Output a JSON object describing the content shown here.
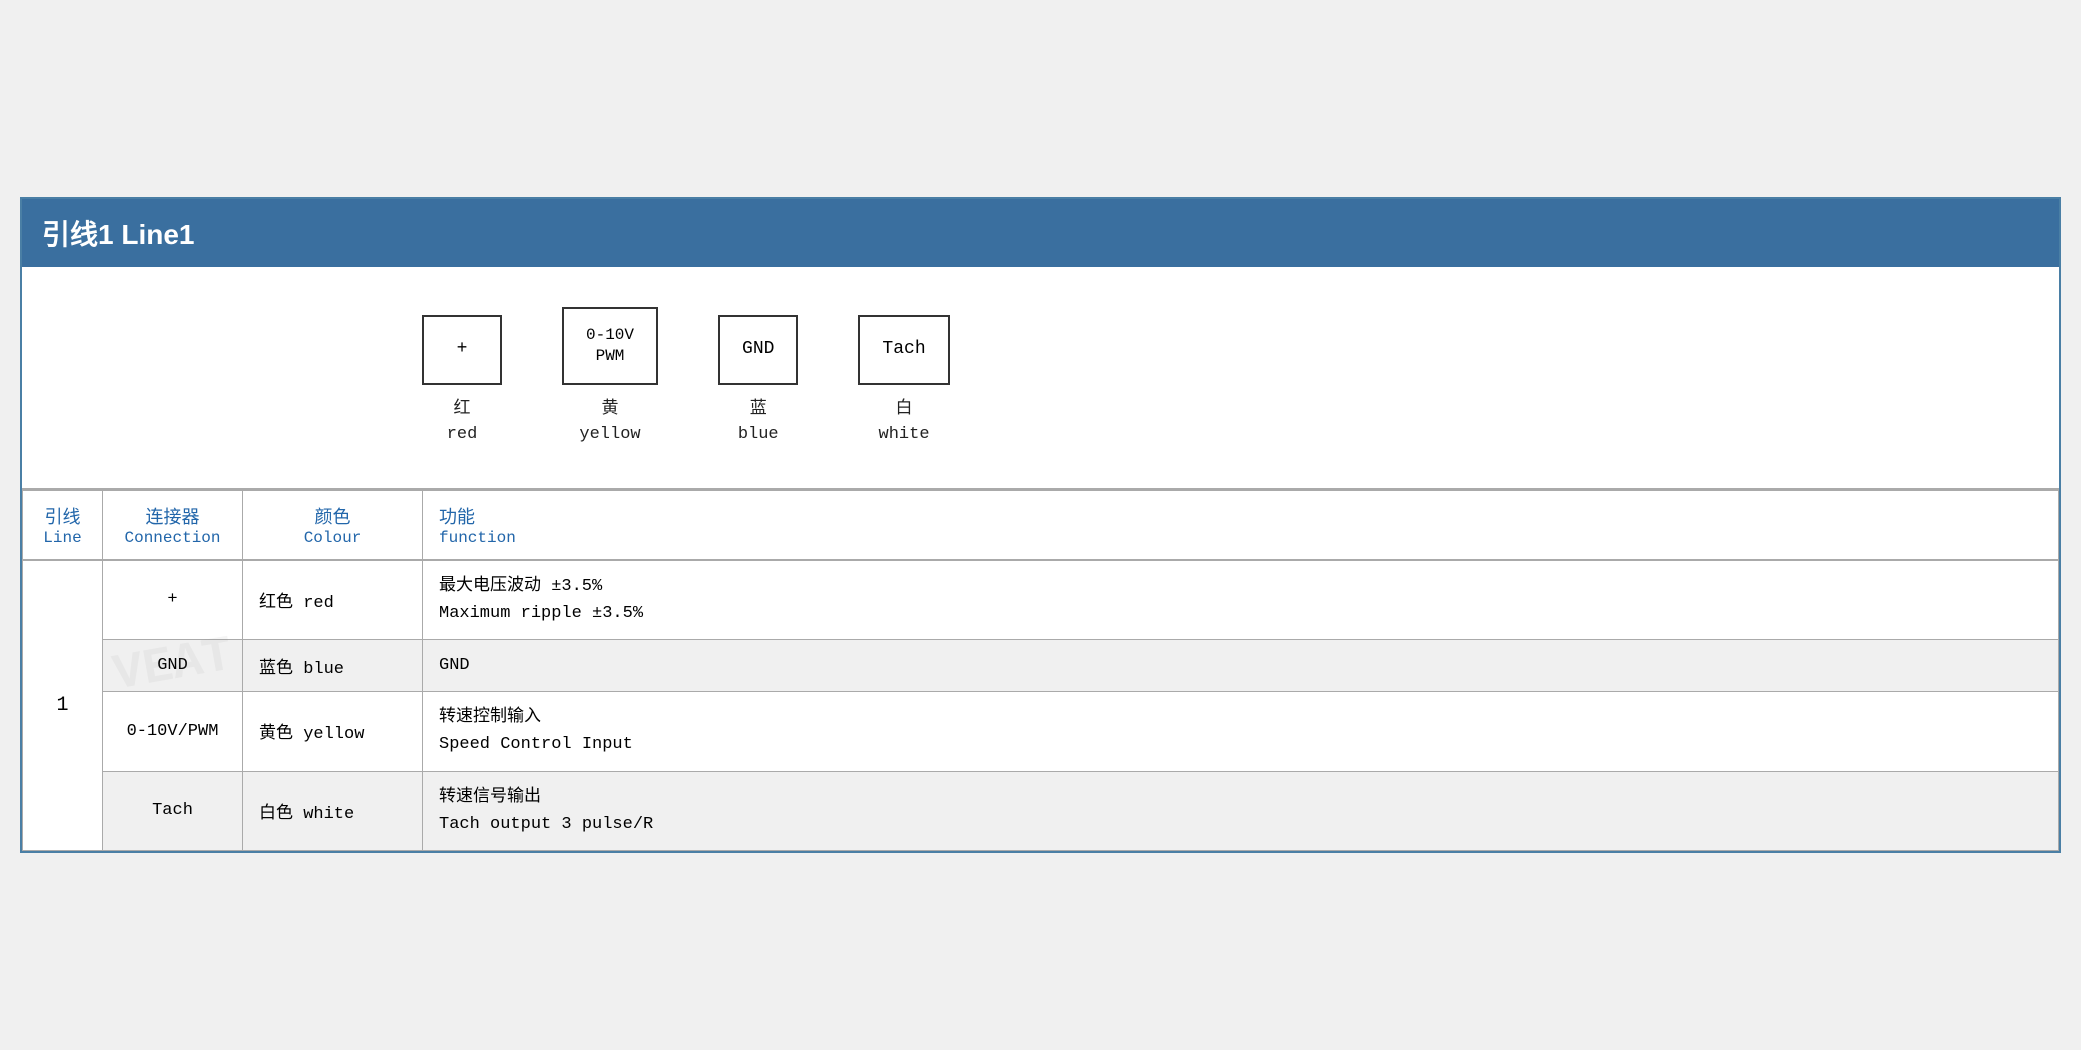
{
  "title": {
    "zh": "引线1 Line1"
  },
  "diagram": {
    "connectors": [
      {
        "id": "plus",
        "symbol": "+",
        "label_zh": "红",
        "label_en": "red"
      },
      {
        "id": "pwm",
        "symbol": "0-10V\nPWM",
        "label_zh": "黄",
        "label_en": "yellow"
      },
      {
        "id": "gnd",
        "symbol": "GND",
        "label_zh": "蓝",
        "label_en": "blue"
      },
      {
        "id": "tach",
        "symbol": "Tach",
        "label_zh": "白",
        "label_en": "white"
      }
    ]
  },
  "table": {
    "headers": [
      {
        "zh": "引线",
        "en": "Line"
      },
      {
        "zh": "连接器",
        "en": "Connection"
      },
      {
        "zh": "颜色",
        "en": "Colour"
      },
      {
        "zh": "功能",
        "en": "function"
      }
    ],
    "rows": [
      {
        "line": "1",
        "connection": "+",
        "colour_zh": "红色",
        "colour_en": "red",
        "func_zh": "最大电压波动 ±3.5%",
        "func_en": "Maximum ripple ±3.5%"
      },
      {
        "line": "",
        "connection": "GND",
        "colour_zh": "蓝色",
        "colour_en": "blue",
        "func_zh": "GND",
        "func_en": ""
      },
      {
        "line": "",
        "connection": "0-10V/PWM",
        "colour_zh": "黄色",
        "colour_en": "yellow",
        "func_zh": "转速控制输入",
        "func_en": "Speed Control Input"
      },
      {
        "line": "",
        "connection": "Tach",
        "colour_zh": "白色",
        "colour_en": "white",
        "func_zh": "转速信号输出",
        "func_en": "Tach output 3 pulse/R"
      }
    ]
  }
}
